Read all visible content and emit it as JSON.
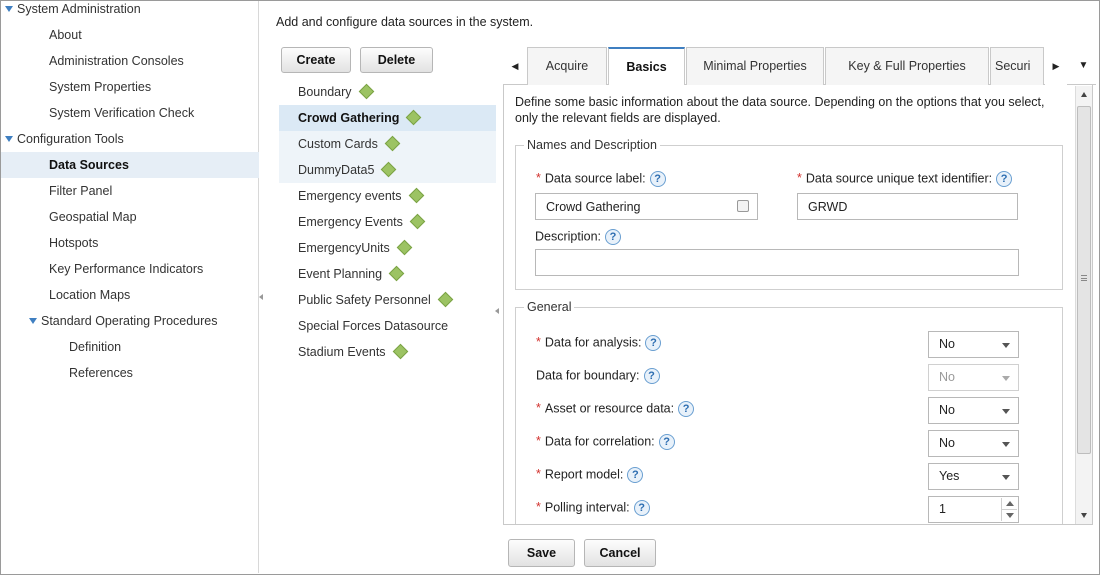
{
  "nav": {
    "items": [
      {
        "label": "System Administration",
        "level": 0,
        "expander": true
      },
      {
        "label": "About",
        "level": 1
      },
      {
        "label": "Administration Consoles",
        "level": 1
      },
      {
        "label": "System Properties",
        "level": 1
      },
      {
        "label": "System Verification Check",
        "level": 1
      },
      {
        "label": "Configuration Tools",
        "level": 0,
        "expander": true
      },
      {
        "label": "Data Sources",
        "level": 1,
        "selected": true
      },
      {
        "label": "Filter Panel",
        "level": 1
      },
      {
        "label": "Geospatial Map",
        "level": 1
      },
      {
        "label": "Hotspots",
        "level": 1
      },
      {
        "label": "Key Performance Indicators",
        "level": 1
      },
      {
        "label": "Location Maps",
        "level": 1
      },
      {
        "label": "Standard Operating Procedures",
        "level": 1,
        "expander": true
      },
      {
        "label": "Definition",
        "level": 2
      },
      {
        "label": "References",
        "level": 2
      }
    ]
  },
  "header": {
    "description": "Add and configure data sources in the system."
  },
  "toolbar": {
    "create_label": "Create",
    "delete_label": "Delete"
  },
  "data_sources": [
    {
      "label": "Boundary",
      "diamond": true
    },
    {
      "label": "Crowd Gathering",
      "diamond": true,
      "selected": true
    },
    {
      "label": "Custom Cards",
      "diamond": true,
      "hover": true
    },
    {
      "label": "DummyData5",
      "diamond": true,
      "hover": true
    },
    {
      "label": "Emergency events",
      "diamond": true
    },
    {
      "label": "Emergency Events",
      "diamond": true
    },
    {
      "label": "EmergencyUnits",
      "diamond": true
    },
    {
      "label": "Event Planning",
      "diamond": true
    },
    {
      "label": "Public Safety Personnel",
      "diamond": true
    },
    {
      "label": "Special Forces Datasource",
      "diamond": false
    },
    {
      "label": "Stadium Events",
      "diamond": true
    }
  ],
  "tabs": [
    {
      "label": "Acquire"
    },
    {
      "label": "Basics",
      "active": true
    },
    {
      "label": "Minimal Properties"
    },
    {
      "label": "Key & Full Properties"
    },
    {
      "label": "Securi"
    }
  ],
  "form": {
    "intro": "Define some basic information about the data source. Depending on the options that you select, only the relevant fields are displayed.",
    "names_section": "Names and Description",
    "label_label": "Data source label:",
    "label_value": "Crowd Gathering",
    "identifier_label": "Data source unique text identifier:",
    "identifier_value": "GRWD",
    "description_label": "Description:",
    "description_value": "",
    "general_section": "General",
    "general_fields": [
      {
        "label": "Data for analysis:",
        "required": true,
        "value": "No",
        "kind": "select"
      },
      {
        "label": "Data for boundary:",
        "required": false,
        "value": "No",
        "kind": "select",
        "disabled": true
      },
      {
        "label": "Asset or resource data:",
        "required": true,
        "value": "No",
        "kind": "select"
      },
      {
        "label": "Data for correlation:",
        "required": true,
        "value": "No",
        "kind": "select"
      },
      {
        "label": "Report model:",
        "required": true,
        "value": "Yes",
        "kind": "select"
      },
      {
        "label": "Polling interval:",
        "required": true,
        "value": "1",
        "kind": "spinner"
      }
    ],
    "help_glyph": "?",
    "required_glyph": "*"
  },
  "footer": {
    "save_label": "Save",
    "cancel_label": "Cancel"
  },
  "colors": {
    "accent": "#3f7fc1",
    "selection": "#dbe9f5",
    "required": "#d2302c",
    "diamond": "#9cc363"
  }
}
